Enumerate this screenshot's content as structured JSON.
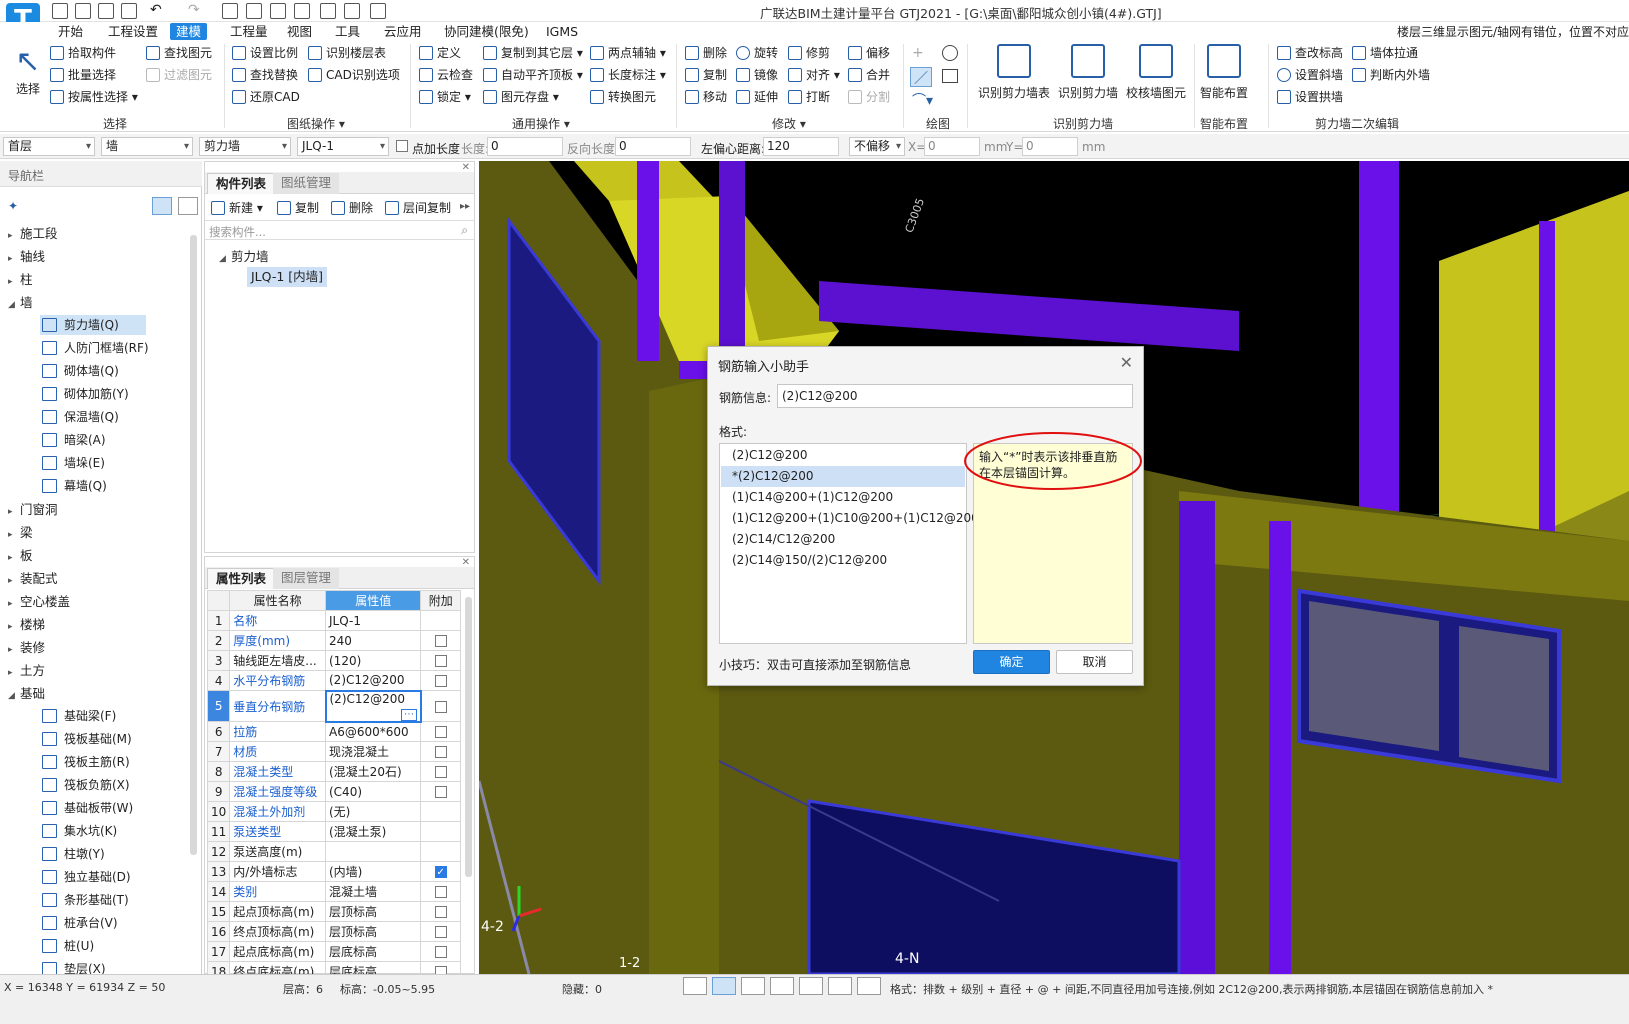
{
  "app": {
    "title": "广联达BIM土建计量平台 GTJ2021 - [G:\\桌面\\鄱阳城众创小镇(4#).GTJ]",
    "logo": "T",
    "notice": "楼层三维显示图元/轴网有错位，位置不对应"
  },
  "menu": [
    "开始",
    "工程设置",
    "建模",
    "工程量",
    "视图",
    "工具",
    "云应用",
    "协同建模(限免)",
    "IGMS"
  ],
  "ribbon": {
    "select": {
      "big": "选择",
      "items": [
        "拾取构件",
        "批量选择",
        "按属性选择",
        "查找图元",
        "过滤图元"
      ],
      "group": "选择"
    },
    "drawing": {
      "items": [
        "设置比例",
        "识别楼层表",
        "查找替换",
        "CAD识别选项",
        "还原CAD"
      ],
      "group": "图纸操作"
    },
    "general": {
      "items": [
        "定义",
        "复制到其它层",
        "两点辅轴",
        "云检查",
        "自动平齐顶板",
        "长度标注",
        "锁定",
        "图元存盘",
        "转换图元"
      ],
      "group": "通用操作"
    },
    "modify": {
      "items": [
        "删除",
        "旋转",
        "修剪",
        "偏移",
        "复制",
        "镜像",
        "对齐",
        "合并",
        "移动",
        "延伸",
        "打断",
        "分割"
      ],
      "group": "修改"
    },
    "draw": {
      "group": "绘图"
    },
    "recognize": {
      "items": [
        "识别剪力墙表",
        "识别剪力墙",
        "校核墙图元"
      ],
      "group": "识别剪力墙"
    },
    "smart": {
      "items": [
        "智能布置"
      ],
      "group": "智能布置"
    },
    "edit2": {
      "items": [
        "查改标高",
        "墙体拉通",
        "设置斜墙",
        "判断内外墙",
        "设置拱墙"
      ],
      "group": "剪力墙二次编辑"
    }
  },
  "toolbar": {
    "floor": "首层",
    "type": "墙",
    "subtype": "剪力墙",
    "component": "JLQ-1",
    "point_len": "点加长度",
    "len_label": "长度:",
    "len_val": "0",
    "rev_label": "反向长度:",
    "rev_val": "0",
    "offset_label": "左偏心距离:",
    "offset_val": "120",
    "nooffset": "不偏移",
    "x_label": "X=",
    "x_val": "0",
    "unit1": "mm",
    "y_label": "Y=",
    "y_val": "0",
    "unit2": "mm"
  },
  "nav": {
    "title": "导航栏",
    "items": [
      "施工段",
      "轴线",
      "柱",
      "墙"
    ],
    "wall_items": [
      "剪力墙(Q)",
      "人防门框墙(RF)",
      "砌体墙(Q)",
      "砌体加筋(Y)",
      "保温墙(Q)",
      "暗梁(A)",
      "墙垛(E)",
      "幕墙(Q)"
    ],
    "items2": [
      "门窗洞",
      "梁",
      "板",
      "装配式",
      "空心楼盖",
      "楼梯",
      "装修",
      "土方",
      "基础"
    ],
    "base_items": [
      "基础梁(F)",
      "筏板基础(M)",
      "筏板主筋(R)",
      "筏板负筋(X)",
      "基础板带(W)",
      "集水坑(K)",
      "柱墩(Y)",
      "独立基础(D)",
      "条形基础(T)",
      "桩承台(V)",
      "桩(U)",
      "垫层(X)"
    ]
  },
  "comp": {
    "tab1": "构件列表",
    "tab2": "图纸管理",
    "new": "新建",
    "copy": "复制",
    "delete": "删除",
    "floorcopy": "层间复制",
    "search_placeholder": "搜索构件...",
    "tree_root": "剪力墙",
    "tree_item": "JLQ-1 [内墙]"
  },
  "props": {
    "tab1": "属性列表",
    "tab2": "图层管理",
    "col_name": "属性名称",
    "col_val": "属性值",
    "col_add": "附加",
    "rows": [
      {
        "n": "1",
        "name": "名称",
        "val": "JLQ-1",
        "blue": true,
        "cb": "none"
      },
      {
        "n": "2",
        "name": "厚度(mm)",
        "val": "240",
        "blue": true,
        "cb": "off"
      },
      {
        "n": "3",
        "name": "轴线距左墙皮...",
        "val": "(120)",
        "blue": false,
        "cb": "off"
      },
      {
        "n": "4",
        "name": "水平分布钢筋",
        "val": "(2)C12@200",
        "blue": true,
        "cb": "off"
      },
      {
        "n": "5",
        "name": "垂直分布钢筋",
        "val": "(2)C12@200",
        "blue": true,
        "cb": "off"
      },
      {
        "n": "6",
        "name": "拉筋",
        "val": "A6@600*600",
        "blue": true,
        "cb": "off"
      },
      {
        "n": "7",
        "name": "材质",
        "val": "现浇混凝土",
        "blue": true,
        "cb": "off"
      },
      {
        "n": "8",
        "name": "混凝土类型",
        "val": "(混凝土20石)",
        "blue": true,
        "cb": "off"
      },
      {
        "n": "9",
        "name": "混凝土强度等级",
        "val": "(C40)",
        "blue": true,
        "cb": "off"
      },
      {
        "n": "10",
        "name": "混凝土外加剂",
        "val": "(无)",
        "blue": true,
        "cb": "none"
      },
      {
        "n": "11",
        "name": "泵送类型",
        "val": "(混凝土泵)",
        "blue": true,
        "cb": "none"
      },
      {
        "n": "12",
        "name": "泵送高度(m)",
        "val": "",
        "blue": false,
        "cb": "none"
      },
      {
        "n": "13",
        "name": "内/外墙标志",
        "val": "(内墙)",
        "blue": false,
        "cb": "on"
      },
      {
        "n": "14",
        "name": "类别",
        "val": "混凝土墙",
        "blue": true,
        "cb": "off"
      },
      {
        "n": "15",
        "name": "起点顶标高(m)",
        "val": "层顶标高",
        "blue": false,
        "cb": "off"
      },
      {
        "n": "16",
        "name": "终点顶标高(m)",
        "val": "层顶标高",
        "blue": false,
        "cb": "off"
      },
      {
        "n": "17",
        "name": "起点底标高(m)",
        "val": "层底标高",
        "blue": false,
        "cb": "off"
      },
      {
        "n": "18",
        "name": "终点底标高(m)",
        "val": "层底标高",
        "blue": false,
        "cb": "off"
      }
    ]
  },
  "dialog": {
    "title": "钢筋输入小助手",
    "info_label": "钢筋信息:",
    "info_value": "(2)C12@200",
    "format_label": "格式:",
    "formats": [
      "(2)C12@200",
      "*(2)C12@200",
      "(1)C14@200+(1)C12@200",
      "(1)C12@200+(1)C10@200+(1)C12@200",
      "(2)C14/C12@200",
      "(2)C14@150/(2)C12@200"
    ],
    "hint": "输入“*”时表示该排垂直筋在本层锚固计算。",
    "tip": "小技巧：双击可直接添加至钢筋信息",
    "ok": "确定",
    "cancel": "取消"
  },
  "viewport": {
    "axis1": "4-2",
    "axis2": "4-N",
    "axis3": "1-2",
    "text1": "C3005"
  },
  "status": {
    "coords": "X = 16348 Y = 61934 Z = 50",
    "floor_h": "层高：6",
    "elev": "标高：-0.05~5.95",
    "hidden": "隐藏：0",
    "hint": "格式：排数 + 级别 + 直径 + @ + 间距,不同直径用加号连接,例如 2C12@200,表示两排钢筋,本层锚固在钢筋信息前加入 *"
  },
  "colors": {
    "accent": "#1f85e0",
    "wall_olive": "#5c5a10",
    "wall_yellow": "#c6c41c",
    "column_purple": "#6a10e8"
  }
}
